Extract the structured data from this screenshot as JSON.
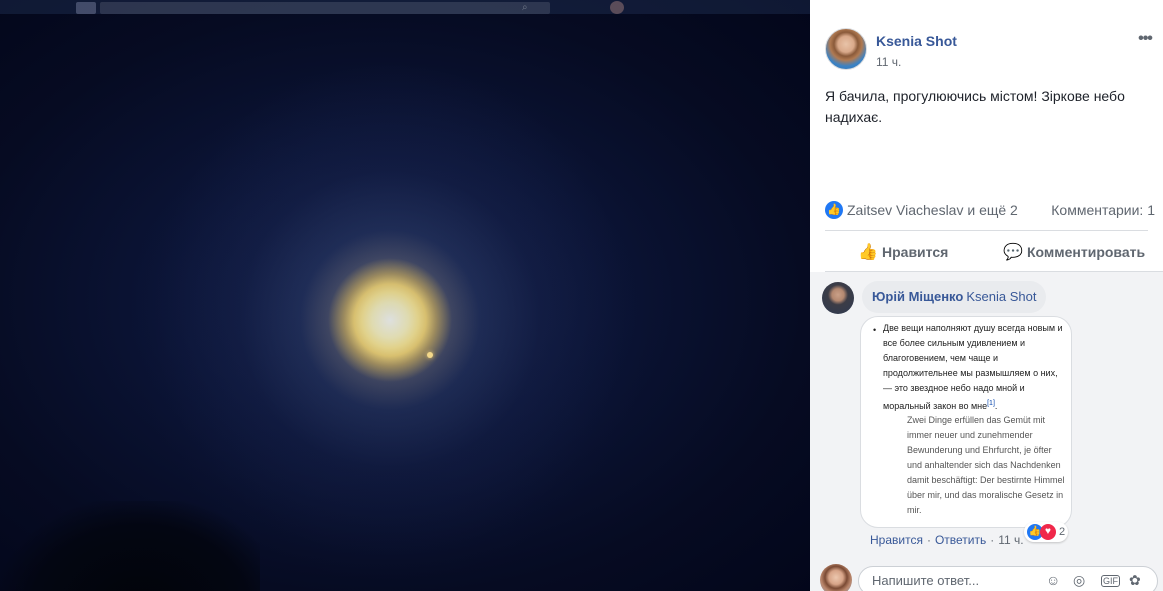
{
  "post": {
    "author": "Ksenia Shot",
    "time": "11 ч.",
    "text": "Я бачила, прогулюючись містом! Зіркове небо надихає.",
    "more_label": "•••",
    "reactors": "Zaitsev Viacheslav и ещё 2",
    "comments_count": "Комментарии: 1",
    "actions": {
      "like": "Нравится",
      "comment": "Комментировать"
    }
  },
  "comment": {
    "author": "Юрій Міщенко",
    "mention": "Ksenia Shot",
    "image_quote": {
      "ru": "Две вещи наполняют душу всегда новым и все более сильным удивлением и благоговением, чем чаще и продолжительнее мы размышляем о них, — это звездное небо надо мной и моральный закон во мне",
      "ref": "[1]",
      "de": "Zwei Dinge erfüllen das Gemüt mit immer neuer und zunehmender Bewunderung und Ehrfurcht, je öfter und anhaltender sich das Nachdenken damit beschäftigt: Der bestirnte Himmel über mir, und das moralische Gesetz in mir."
    },
    "reactions_count": "2",
    "reply_label": "Нравится",
    "respond_label": "Ответить",
    "time": "11 ч."
  },
  "reply_box": {
    "placeholder": "Напишите ответ..."
  },
  "colors": {
    "link": "#385898",
    "like_blue": "#2078f4",
    "love_red": "#f0284a"
  },
  "icons": [
    "more-icon",
    "like-reaction-icon",
    "thumbs-up-icon",
    "comment-icon",
    "love-reaction-icon",
    "emoji-icon",
    "camera-icon",
    "gif-icon",
    "sticker-icon"
  ]
}
